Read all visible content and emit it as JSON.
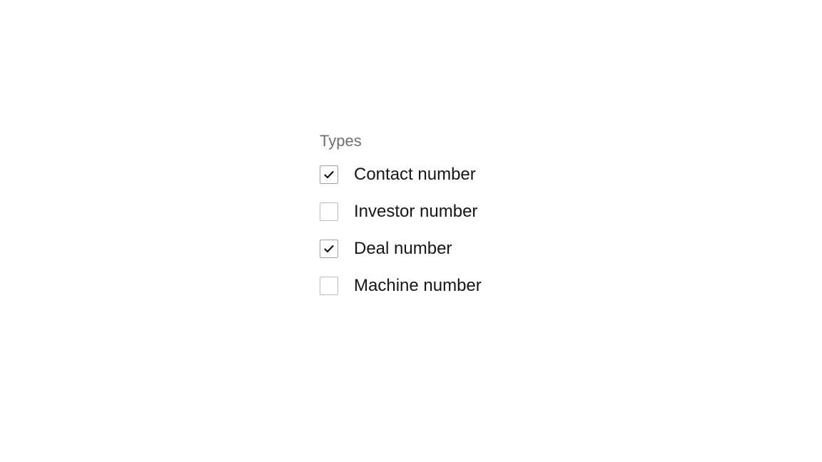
{
  "types": {
    "title": "Types",
    "options": [
      {
        "label": "Contact number",
        "checked": true
      },
      {
        "label": "Investor number",
        "checked": false
      },
      {
        "label": "Deal number",
        "checked": true
      },
      {
        "label": "Machine number",
        "checked": false
      }
    ]
  }
}
